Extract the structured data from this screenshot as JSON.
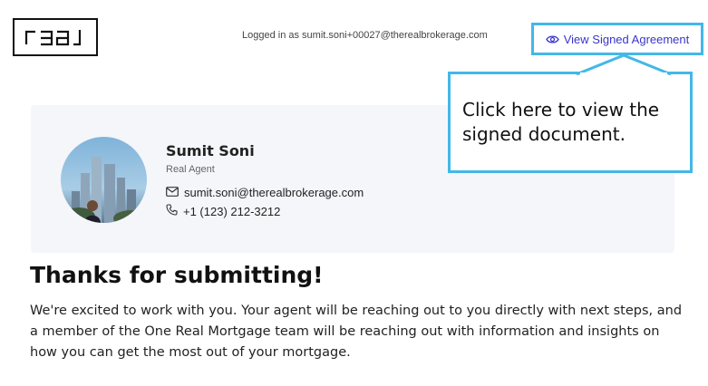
{
  "header": {
    "logo_text": "real",
    "logged_in_text": "Logged in as sumit.soni+00027@therealbrokerage.com",
    "view_button_label": "View Signed Agreement"
  },
  "callout": {
    "text": "Click here to view the signed document."
  },
  "agent": {
    "name": "Sumit Soni",
    "role": "Real Agent",
    "email": "sumit.soni@therealbrokerage.com",
    "phone": "+1 (123) 212-3212"
  },
  "confirmation": {
    "title": "Thanks for submitting!",
    "body": "We're excited to work with you. Your agent will be reaching out to you directly with next steps, and a member of the One Real Mortgage team will be reaching out with information and insights on how you can get the most out of your mortgage."
  },
  "colors": {
    "highlight": "#42b8e8",
    "link": "#3a35c9",
    "card_bg": "#f5f6fa"
  },
  "icons": [
    "eye-icon",
    "mail-icon",
    "phone-icon"
  ]
}
